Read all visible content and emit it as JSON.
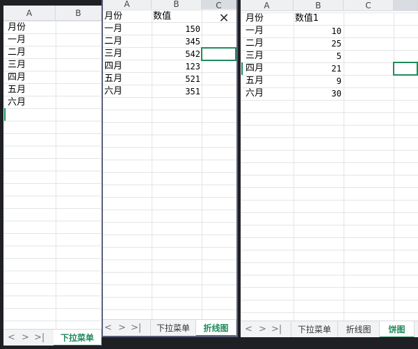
{
  "window_left": {
    "columns": [
      "A",
      "B"
    ],
    "rows": [
      "月份",
      "一月",
      "二月",
      "三月",
      "四月",
      "五月",
      "六月"
    ],
    "tabs": [
      "下拉菜单"
    ],
    "nav_icons": [
      "chevron-left-icon",
      "chevron-right-icon",
      "skip-last-icon"
    ]
  },
  "window_middle": {
    "columns": [
      "A",
      "B",
      "C"
    ],
    "headers": [
      "月份",
      "数值"
    ],
    "rows": [
      {
        "month": "一月",
        "value": "150"
      },
      {
        "month": "二月",
        "value": "345"
      },
      {
        "month": "三月",
        "value": "542"
      },
      {
        "month": "四月",
        "value": "123"
      },
      {
        "month": "五月",
        "value": "521"
      },
      {
        "month": "六月",
        "value": "351"
      }
    ],
    "tabs": [
      "下拉菜单",
      "折线图"
    ],
    "close_glyph": "✕"
  },
  "window_right": {
    "columns": [
      "A",
      "B",
      "C"
    ],
    "headers": [
      "月份",
      "数值1"
    ],
    "rows": [
      {
        "month": "一月",
        "value": "10"
      },
      {
        "month": "二月",
        "value": "25"
      },
      {
        "month": "三月",
        "value": "5"
      },
      {
        "month": "四月",
        "value": "21"
      },
      {
        "month": "五月",
        "value": "9"
      },
      {
        "month": "六月",
        "value": "30"
      }
    ],
    "tabs": [
      "下拉菜单",
      "折线图",
      "饼图"
    ]
  },
  "colors": {
    "accent": "#1e8a5a",
    "grid": "#e2e4e6",
    "header_bg": "#eef0f2",
    "background": "#1f2024"
  }
}
